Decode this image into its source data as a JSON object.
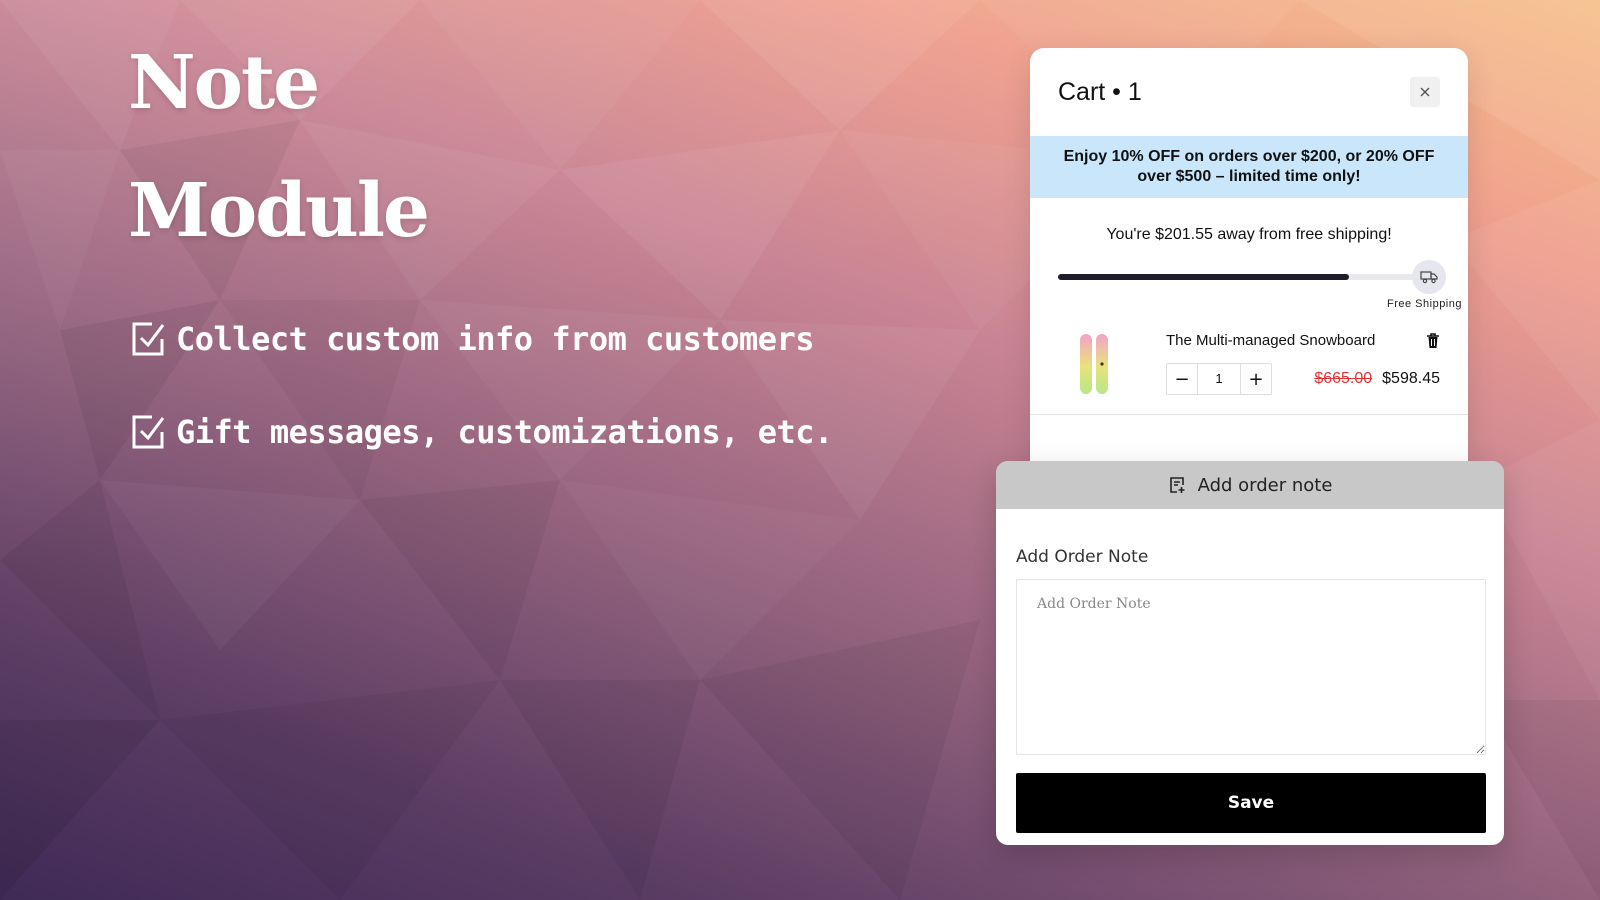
{
  "hero": {
    "title_line1": "Note",
    "title_line2": "Module",
    "features": [
      {
        "icon": "checkbox-checked-icon",
        "text": "Collect custom info from customers"
      },
      {
        "icon": "checkbox-checked-icon",
        "text": "Gift messages, customizations, etc."
      }
    ]
  },
  "cart": {
    "title": "Cart • 1",
    "close_icon": "close-icon",
    "promo_text": "Enjoy 10% OFF on orders over $200, or 20% OFF over $500 – limited time only!",
    "shipping_message": "You're $201.55 away from free shipping!",
    "shipping_progress_percent": 79,
    "free_shipping_label": "Free Shipping",
    "item": {
      "name": "The Multi-managed Snowboard",
      "quantity": "1",
      "original_price": "$665.00",
      "sale_price": "$598.45",
      "delete_icon": "trash-icon"
    }
  },
  "note": {
    "toggle_label": "Add order note",
    "toggle_icon": "note-add-icon",
    "field_label": "Add Order Note",
    "placeholder": "Add Order Note",
    "save_label": "Save"
  },
  "colors": {
    "promo_bg": "#c9e6fb",
    "sale_old_price": "#e03434",
    "save_button": "#000000",
    "note_bar": "#c8c8c8"
  }
}
